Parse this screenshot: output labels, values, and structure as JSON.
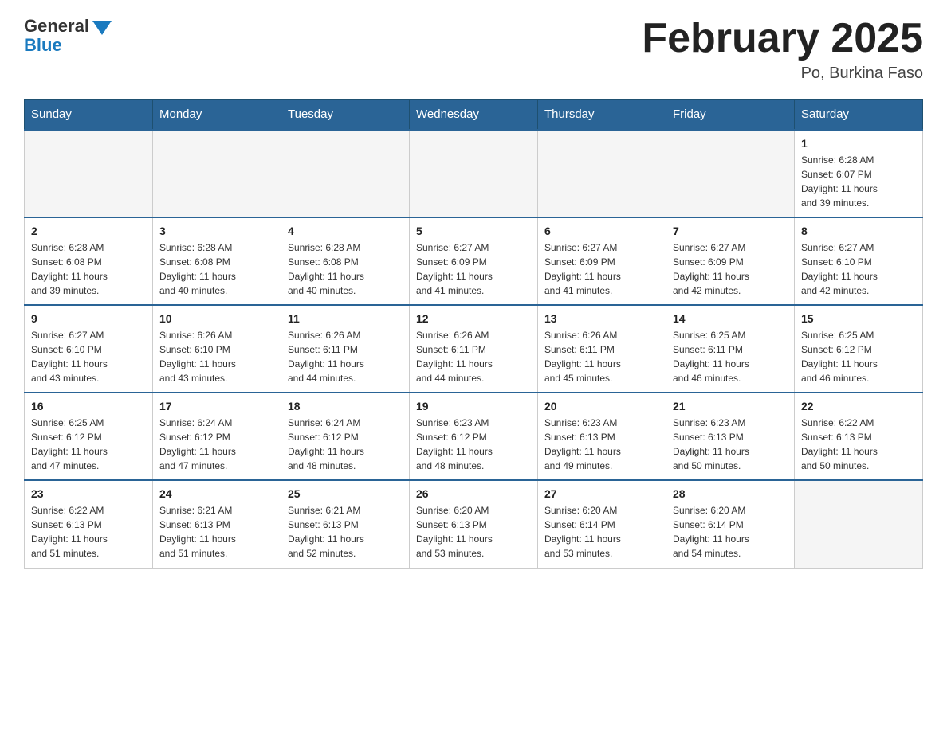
{
  "header": {
    "logo_general": "General",
    "logo_blue": "Blue",
    "month_year": "February 2025",
    "location": "Po, Burkina Faso"
  },
  "days_of_week": [
    "Sunday",
    "Monday",
    "Tuesday",
    "Wednesday",
    "Thursday",
    "Friday",
    "Saturday"
  ],
  "weeks": [
    [
      {
        "day": "",
        "info": ""
      },
      {
        "day": "",
        "info": ""
      },
      {
        "day": "",
        "info": ""
      },
      {
        "day": "",
        "info": ""
      },
      {
        "day": "",
        "info": ""
      },
      {
        "day": "",
        "info": ""
      },
      {
        "day": "1",
        "info": "Sunrise: 6:28 AM\nSunset: 6:07 PM\nDaylight: 11 hours\nand 39 minutes."
      }
    ],
    [
      {
        "day": "2",
        "info": "Sunrise: 6:28 AM\nSunset: 6:08 PM\nDaylight: 11 hours\nand 39 minutes."
      },
      {
        "day": "3",
        "info": "Sunrise: 6:28 AM\nSunset: 6:08 PM\nDaylight: 11 hours\nand 40 minutes."
      },
      {
        "day": "4",
        "info": "Sunrise: 6:28 AM\nSunset: 6:08 PM\nDaylight: 11 hours\nand 40 minutes."
      },
      {
        "day": "5",
        "info": "Sunrise: 6:27 AM\nSunset: 6:09 PM\nDaylight: 11 hours\nand 41 minutes."
      },
      {
        "day": "6",
        "info": "Sunrise: 6:27 AM\nSunset: 6:09 PM\nDaylight: 11 hours\nand 41 minutes."
      },
      {
        "day": "7",
        "info": "Sunrise: 6:27 AM\nSunset: 6:09 PM\nDaylight: 11 hours\nand 42 minutes."
      },
      {
        "day": "8",
        "info": "Sunrise: 6:27 AM\nSunset: 6:10 PM\nDaylight: 11 hours\nand 42 minutes."
      }
    ],
    [
      {
        "day": "9",
        "info": "Sunrise: 6:27 AM\nSunset: 6:10 PM\nDaylight: 11 hours\nand 43 minutes."
      },
      {
        "day": "10",
        "info": "Sunrise: 6:26 AM\nSunset: 6:10 PM\nDaylight: 11 hours\nand 43 minutes."
      },
      {
        "day": "11",
        "info": "Sunrise: 6:26 AM\nSunset: 6:11 PM\nDaylight: 11 hours\nand 44 minutes."
      },
      {
        "day": "12",
        "info": "Sunrise: 6:26 AM\nSunset: 6:11 PM\nDaylight: 11 hours\nand 44 minutes."
      },
      {
        "day": "13",
        "info": "Sunrise: 6:26 AM\nSunset: 6:11 PM\nDaylight: 11 hours\nand 45 minutes."
      },
      {
        "day": "14",
        "info": "Sunrise: 6:25 AM\nSunset: 6:11 PM\nDaylight: 11 hours\nand 46 minutes."
      },
      {
        "day": "15",
        "info": "Sunrise: 6:25 AM\nSunset: 6:12 PM\nDaylight: 11 hours\nand 46 minutes."
      }
    ],
    [
      {
        "day": "16",
        "info": "Sunrise: 6:25 AM\nSunset: 6:12 PM\nDaylight: 11 hours\nand 47 minutes."
      },
      {
        "day": "17",
        "info": "Sunrise: 6:24 AM\nSunset: 6:12 PM\nDaylight: 11 hours\nand 47 minutes."
      },
      {
        "day": "18",
        "info": "Sunrise: 6:24 AM\nSunset: 6:12 PM\nDaylight: 11 hours\nand 48 minutes."
      },
      {
        "day": "19",
        "info": "Sunrise: 6:23 AM\nSunset: 6:12 PM\nDaylight: 11 hours\nand 48 minutes."
      },
      {
        "day": "20",
        "info": "Sunrise: 6:23 AM\nSunset: 6:13 PM\nDaylight: 11 hours\nand 49 minutes."
      },
      {
        "day": "21",
        "info": "Sunrise: 6:23 AM\nSunset: 6:13 PM\nDaylight: 11 hours\nand 50 minutes."
      },
      {
        "day": "22",
        "info": "Sunrise: 6:22 AM\nSunset: 6:13 PM\nDaylight: 11 hours\nand 50 minutes."
      }
    ],
    [
      {
        "day": "23",
        "info": "Sunrise: 6:22 AM\nSunset: 6:13 PM\nDaylight: 11 hours\nand 51 minutes."
      },
      {
        "day": "24",
        "info": "Sunrise: 6:21 AM\nSunset: 6:13 PM\nDaylight: 11 hours\nand 51 minutes."
      },
      {
        "day": "25",
        "info": "Sunrise: 6:21 AM\nSunset: 6:13 PM\nDaylight: 11 hours\nand 52 minutes."
      },
      {
        "day": "26",
        "info": "Sunrise: 6:20 AM\nSunset: 6:13 PM\nDaylight: 11 hours\nand 53 minutes."
      },
      {
        "day": "27",
        "info": "Sunrise: 6:20 AM\nSunset: 6:14 PM\nDaylight: 11 hours\nand 53 minutes."
      },
      {
        "day": "28",
        "info": "Sunrise: 6:20 AM\nSunset: 6:14 PM\nDaylight: 11 hours\nand 54 minutes."
      },
      {
        "day": "",
        "info": ""
      }
    ]
  ]
}
